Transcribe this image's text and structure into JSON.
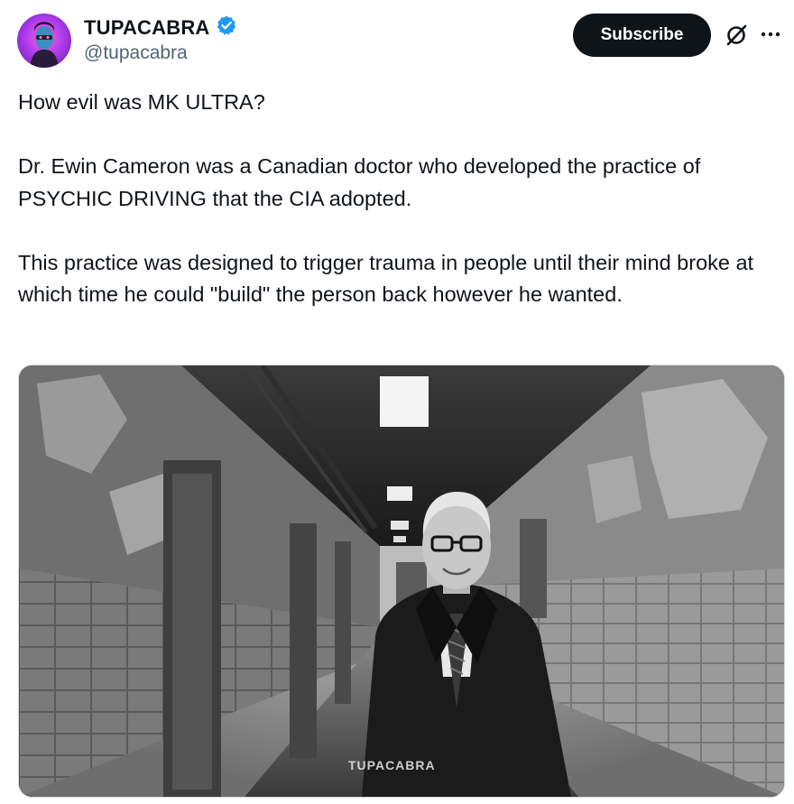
{
  "author": {
    "display_name": "TUPACABRA",
    "handle": "@tupacabra",
    "verified": true,
    "verified_color": "#1d9bf0"
  },
  "actions": {
    "subscribe_label": "Subscribe",
    "grok_icon": "grok-icon",
    "more_icon": "more-icon"
  },
  "tweet": {
    "lines": [
      "How evil was MK ULTRA?",
      "Dr. Ewin Cameron was a Canadian doctor who developed the practice of PSYCHIC DRIVING that the CIA adopted.",
      "This practice was designed to trigger trauma in people until their mind broke at which time he could \"build\" the person back however he wanted."
    ]
  },
  "media": {
    "watermark": "TUPACABRA"
  }
}
